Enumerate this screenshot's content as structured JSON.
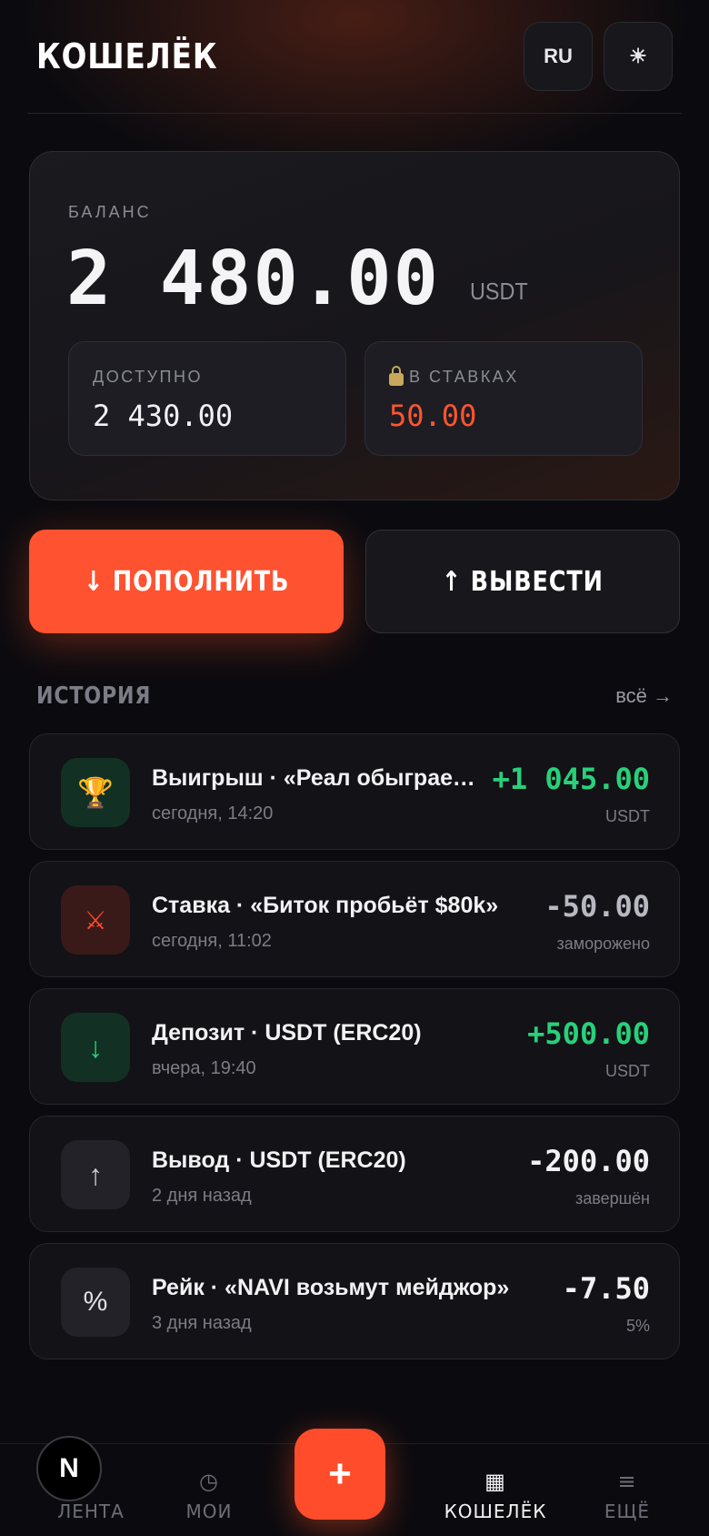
{
  "header": {
    "title": "КОШЕЛЁК",
    "lang_label": "RU",
    "theme_icon": "☀"
  },
  "balance": {
    "label": "БАЛАНС",
    "amount": "2 480.00",
    "currency": "USDT",
    "available_label": "ДОСТУПНО",
    "available_value": "2 430.00",
    "staked_label": "В СТАВКАХ",
    "staked_value": "50.00"
  },
  "actions": {
    "deposit_label": "↓ ПОПОЛНИТЬ",
    "withdraw_label": "↑ ВЫВЕСТИ"
  },
  "history": {
    "title": "ИСТОРИЯ",
    "all_link": "всё →",
    "items": [
      {
        "icon": "trophy-icon",
        "glyph": "🏆",
        "title": "Выигрыш · «Реал обыграет Барселону»",
        "time": "сегодня, 14:20",
        "amount": "+1 045.00",
        "sub": "USDT",
        "color": "#29d07a"
      },
      {
        "icon": "crossed-swords-icon",
        "glyph": "⚔",
        "title": "Ставка · «Биток пробьёт $80k»",
        "time": "сегодня, 11:02",
        "amount": "-50.00",
        "sub": "заморожено",
        "color": "#b8b8c0"
      },
      {
        "icon": "arrow-down-icon",
        "glyph": "↓",
        "title": "Депозит · USDT (ERC20)",
        "time": "вчера, 19:40",
        "amount": "+500.00",
        "sub": "USDT",
        "color": "#29d07a"
      },
      {
        "icon": "arrow-up-icon",
        "glyph": "↑",
        "title": "Вывод · USDT (ERC20)",
        "time": "2 дня назад",
        "amount": "-200.00",
        "sub": "завершён",
        "color": "#f2f2f4"
      },
      {
        "icon": "percent-icon",
        "glyph": "%",
        "title": "Рейк · «NAVI возьмут мейджор»",
        "time": "3 дня назад",
        "amount": "-7.50",
        "sub": "5%",
        "color": "#f2f2f4"
      }
    ]
  },
  "tabbar": {
    "feed_label": "ЛЕНТА",
    "my_label": "МОИ",
    "my_icon": "◷",
    "add_icon": "+",
    "wallet_label": "КОШЕЛЁК",
    "wallet_icon": "▦",
    "more_label": "ЕЩЁ",
    "more_icon": "≡",
    "logo_letter": "N"
  },
  "colors": {
    "accent": "#ff5230",
    "positive": "#29d07a",
    "background": "#0b0b0f"
  }
}
